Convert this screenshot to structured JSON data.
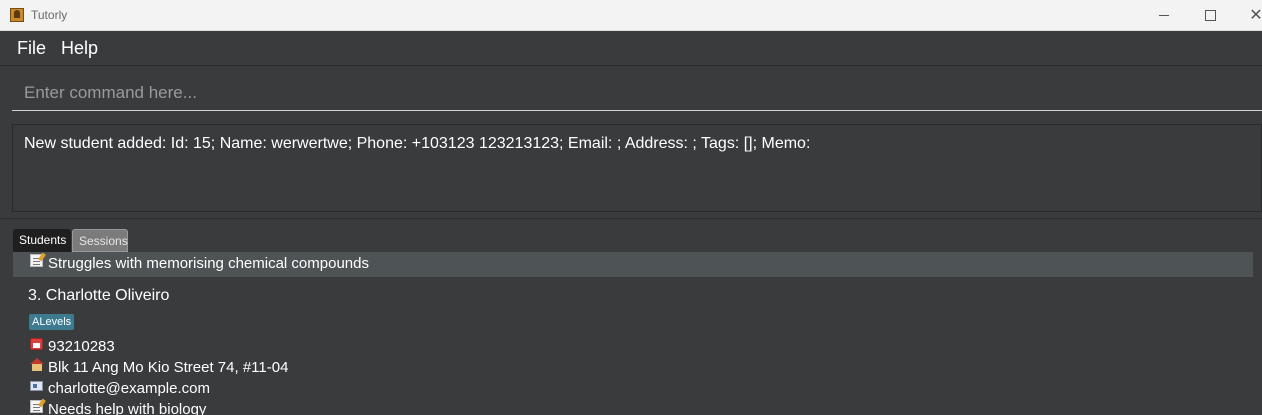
{
  "window": {
    "title": "Tutorly",
    "minimize_glyph": "",
    "maximize_glyph": "",
    "close_glyph": "✕"
  },
  "menu": {
    "file_label": "File",
    "help_label": "Help"
  },
  "command": {
    "placeholder": "Enter command here...",
    "value": ""
  },
  "result": {
    "text": "New student added: Id: 15; Name: werwertwe; Phone: +103123 123213123; Email: ; Address: ; Tags: []; Memo:"
  },
  "tabs": [
    {
      "label": "Students",
      "selected": true
    },
    {
      "label": "Sessions",
      "selected": false
    }
  ],
  "list": {
    "previous_card_memo": "Struggles with memorising chemical compounds",
    "card": {
      "title": "3. Charlotte Oliveiro",
      "tag": "ALevels",
      "phone": "93210283",
      "address": "Blk 11 Ang Mo Kio Street 74, #11-04",
      "email": "charlotte@example.com",
      "memo": "Needs help with biology"
    }
  },
  "colors": {
    "background": "#3a3b3d",
    "selected_row": "#4e5355",
    "tag": "#3e7b91",
    "selected_tab": "#1f1f1f",
    "unselected_tab": "#7b7b7b"
  },
  "icons": [
    "app-icon",
    "memo-icon",
    "phone-icon",
    "house-icon",
    "email-icon"
  ]
}
